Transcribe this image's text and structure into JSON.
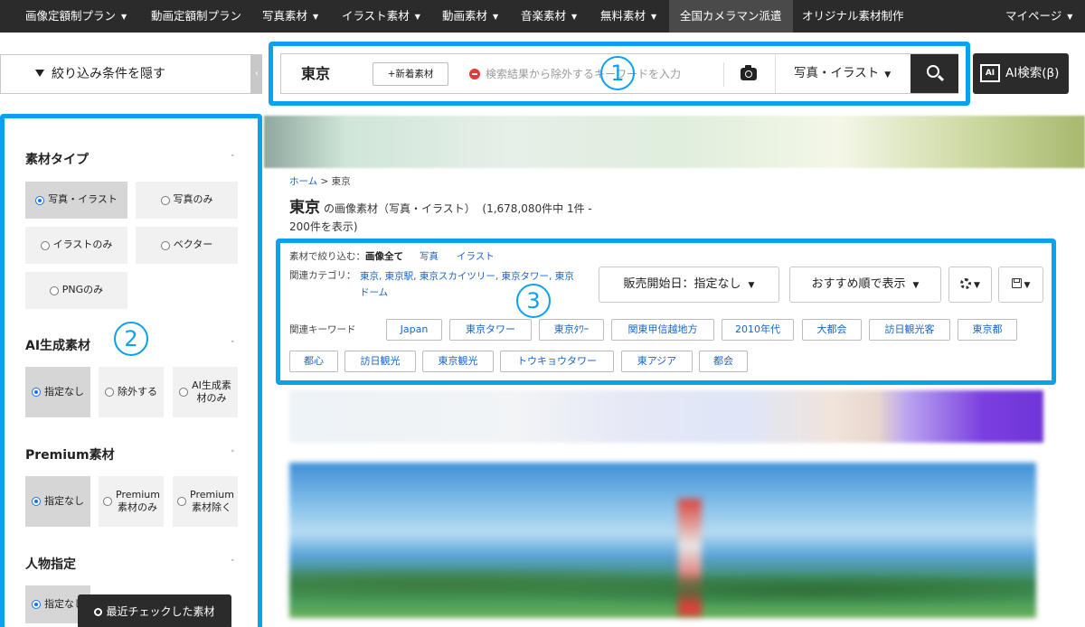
{
  "nav": {
    "items": [
      {
        "label": "画像定額制プラン",
        "caret": true
      },
      {
        "label": "動画定額制プラン",
        "caret": false
      },
      {
        "label": "写真素材",
        "caret": true
      },
      {
        "label": "イラスト素材",
        "caret": true
      },
      {
        "label": "動画素材",
        "caret": true
      },
      {
        "label": "音楽素材",
        "caret": true
      },
      {
        "label": "無料素材",
        "caret": true
      },
      {
        "label": "全国カメラマン派遣",
        "caret": false
      },
      {
        "label": "オリジナル素材制作",
        "caret": false
      }
    ],
    "mypage": "マイページ",
    "caret_glyph": "▼"
  },
  "filter_toggle": {
    "label": "絞り込み条件を隠す",
    "collapse_glyph": "‹"
  },
  "search": {
    "keyword": "東京",
    "new_button": "+新着素材",
    "exclude_placeholder": "検索結果から除外するキーワードを入力",
    "type_select": "写真・イラスト"
  },
  "ai_search": {
    "chip": "AI",
    "label": "AI検索(β)"
  },
  "badges": {
    "one": "1",
    "two": "2",
    "three": "3"
  },
  "sidebar": {
    "material_type": {
      "title": "素材タイプ",
      "options": [
        "写真・イラスト",
        "写真のみ",
        "イラストのみ",
        "ベクター",
        "PNGのみ"
      ]
    },
    "ai_generated": {
      "title": "AI生成素材",
      "options": [
        "指定なし",
        "除外する",
        "AI生成素材のみ"
      ]
    },
    "premium": {
      "title": "Premium素材",
      "options": [
        "指定なし",
        "Premium素材のみ",
        "Premium素材除く"
      ]
    },
    "person": {
      "title": "人物指定",
      "options": [
        "指定なし"
      ]
    },
    "chevron": "˄"
  },
  "recent_button": "最近チェックした素材",
  "breadcrumb": {
    "home": "ホーム",
    "sep": " > ",
    "current": "東京"
  },
  "result": {
    "keyword": "東京",
    "suffix": "の画像素材（写真・イラスト）",
    "count": "(1,678,080件中 1件 - 200件を表示)"
  },
  "material_filter": {
    "label": "素材で絞り込む：",
    "current": "画像全て",
    "links": [
      "写真",
      "イラスト"
    ]
  },
  "related_category": {
    "label": "関連カテゴリ：",
    "links": "東京, 東京駅, 東京スカイツリー, 東京タワー, 東京ドーム"
  },
  "sort": {
    "release_date": "販売開始日：指定なし",
    "order": "おすすめ順で表示"
  },
  "related_keywords": {
    "label": "関連キーワード",
    "tags": [
      "Japan",
      "東京タワー",
      "東京ﾀﾜｰ",
      "関東甲信越地方",
      "2010年代",
      "大都会",
      "訪日観光客",
      "東京都",
      "都心",
      "訪日観光",
      "東京観光",
      "トウキョウタワー",
      "東アジア",
      "都会"
    ]
  },
  "colors": {
    "highlight": "#0aa2f0",
    "nav_bg": "#2b2b2b",
    "link": "#1a64c8",
    "radio_selected": "#1a73e8",
    "exclude_icon": "#e03a3a"
  }
}
